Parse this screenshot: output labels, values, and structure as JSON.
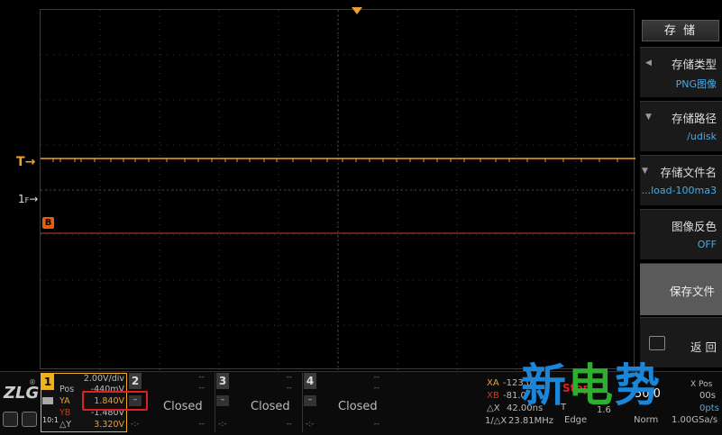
{
  "waveform": {
    "trigger_marker": "T",
    "ch1_marker": "1",
    "cursor_b_label": "B",
    "colors": {
      "trace": "#f0a030",
      "cursor_b": "#d04020",
      "grid": "#3a3a3a"
    }
  },
  "menu": {
    "title": "存 储",
    "items": [
      {
        "label": "存储类型",
        "value": "PNG图像",
        "icon": "left-arrow-icon"
      },
      {
        "label": "存储路径",
        "value": "/udisk",
        "icon": "down-arrow-icon"
      },
      {
        "label": "存储文件名",
        "value": "...load-100ma3",
        "icon": "down-arrow-icon"
      },
      {
        "label": "图像反色",
        "value": "OFF"
      },
      {
        "label": "保存文件"
      },
      {
        "label": "返 回",
        "icon": "back-icon"
      }
    ]
  },
  "bottom": {
    "logo": "ZLG",
    "logo_reg": "®",
    "ch1": {
      "num": "1",
      "scale": "2.00V/div",
      "pos_label": "Pos",
      "pos_value": "-440mV",
      "ya_label": "YA",
      "ya_value": "1.840V",
      "yb_label": "YB",
      "yb_value": "-1.480V",
      "dy_label": "△Y",
      "dy_value": "3.320V",
      "probe": "10:1"
    },
    "channels": [
      {
        "num": "2",
        "status": "Closed"
      },
      {
        "num": "3",
        "status": "Closed"
      },
      {
        "num": "4",
        "status": "Closed"
      }
    ],
    "dashes": "--",
    "measure": {
      "xa_label": "XA",
      "xa_value": "-123.0",
      "xb_label": "XB",
      "xb_value": "-81.0",
      "dx_label": "△X",
      "dx_value": "42.00ns",
      "inv_dx_label": "1/△X",
      "inv_dx_value": "23.81MHz",
      "stop": "Stop",
      "trig_level": "1.6",
      "edge": "Edge",
      "timebase": "50.0",
      "x_pos_label": "X Pos",
      "x_pos_value": "00s",
      "pts": "0pts",
      "mode": "Norm",
      "rate": "1.00GSa/s",
      "t_label": "T"
    },
    "watermark": [
      "新",
      "电",
      "势"
    ]
  }
}
